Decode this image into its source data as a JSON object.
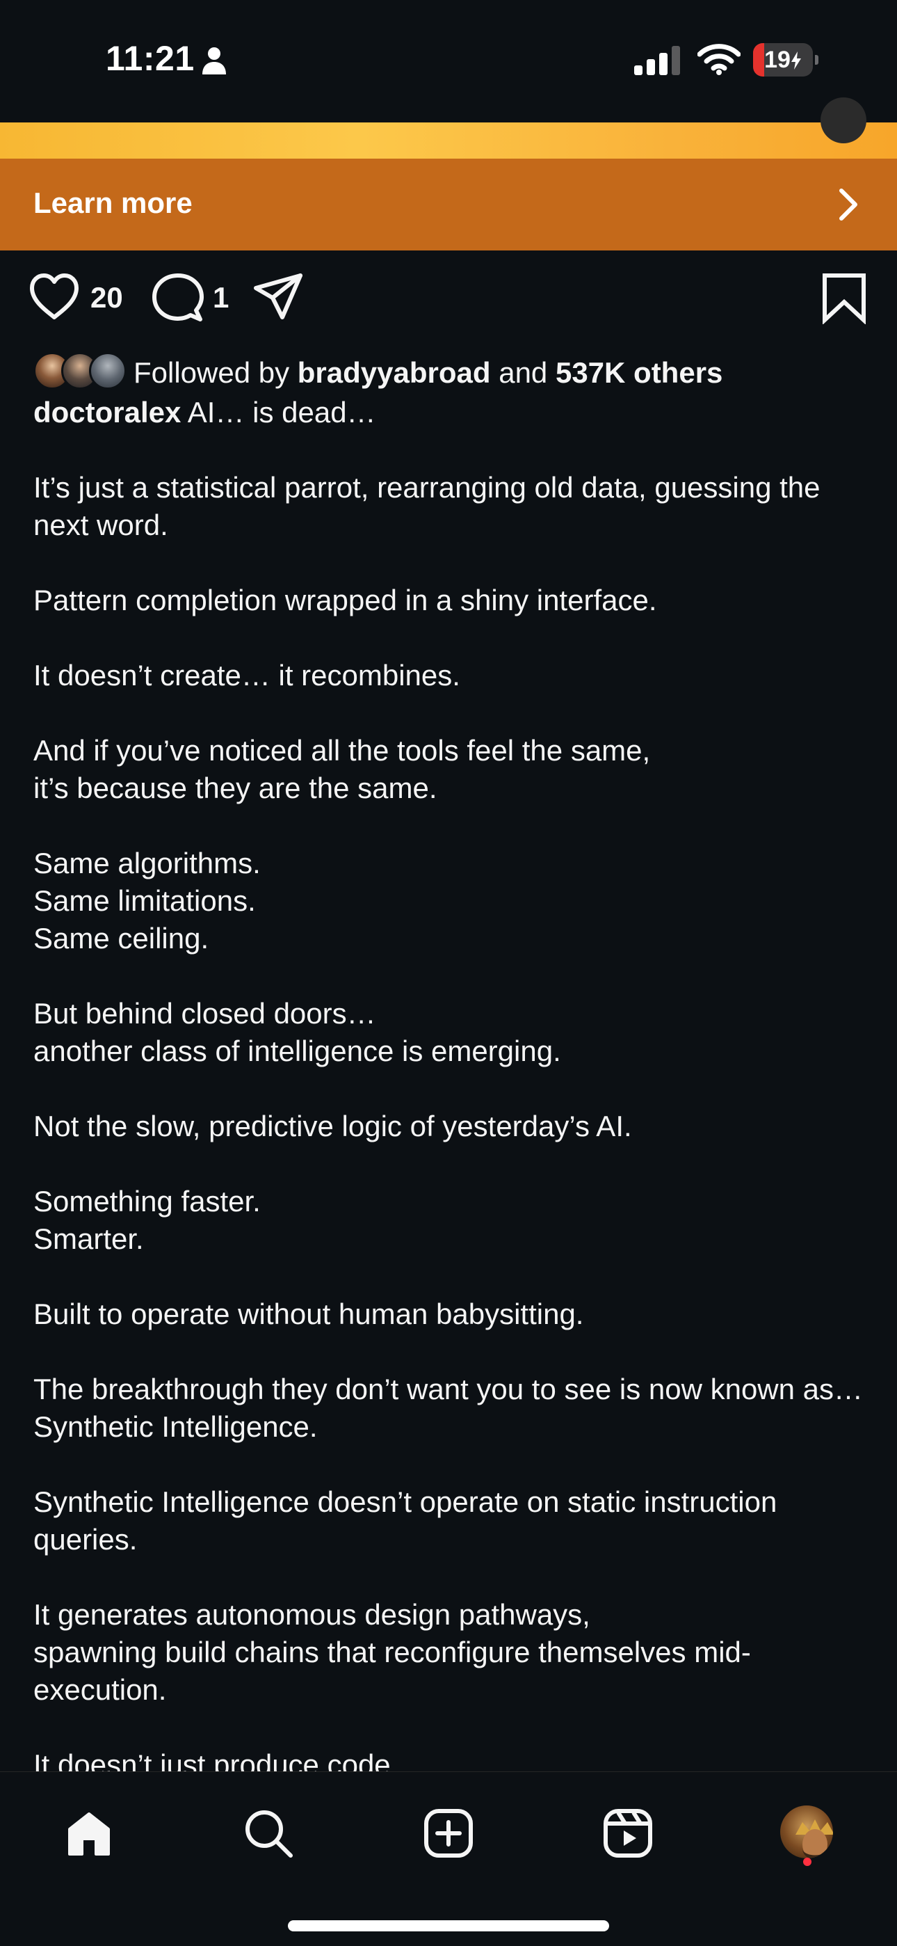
{
  "status_bar": {
    "time": "11:21",
    "battery_level": "19"
  },
  "ad": {
    "cta_label": "Learn more"
  },
  "actions": {
    "like_count": "20",
    "comment_count": "1"
  },
  "social_proof": {
    "prefix": "Followed by",
    "user": "bradyyabroad",
    "joiner": "and",
    "others": "537K others"
  },
  "post": {
    "username": "doctoralex",
    "first_line": "AI… is dead…",
    "paragraphs": [
      [
        "It’s just a statistical parrot, rearranging old data, guessing the next word."
      ],
      [
        "Pattern completion wrapped in a shiny interface."
      ],
      [
        "It doesn’t create… it recombines."
      ],
      [
        "And if you’ve noticed all the tools feel the same,",
        "it’s because they are the same."
      ],
      [
        "Same algorithms.",
        "Same limitations.",
        "Same ceiling."
      ],
      [
        "But behind closed doors…",
        "another class of intelligence is emerging."
      ],
      [
        "Not the slow, predictive logic of yesterday’s AI."
      ],
      [
        "Something faster.",
        "Smarter."
      ],
      [
        "Built to operate without human babysitting."
      ],
      [
        "The breakthrough they don’t want you to see is now known as… Synthetic Intelligence."
      ],
      [
        "Synthetic Intelligence doesn’t operate on static instruction queries."
      ],
      [
        "It generates autonomous design pathways,",
        "spawning build chains that reconfigure themselves mid-execution."
      ],
      [
        "It doesn’t just produce code…"
      ]
    ]
  },
  "nav": {
    "items": [
      "home-icon",
      "search-icon",
      "create-icon",
      "reels-icon",
      "profile-avatar"
    ]
  },
  "colors": {
    "background": "#0c1014",
    "cta_bar": "#c4691a",
    "battery_low": "#e5322d"
  }
}
